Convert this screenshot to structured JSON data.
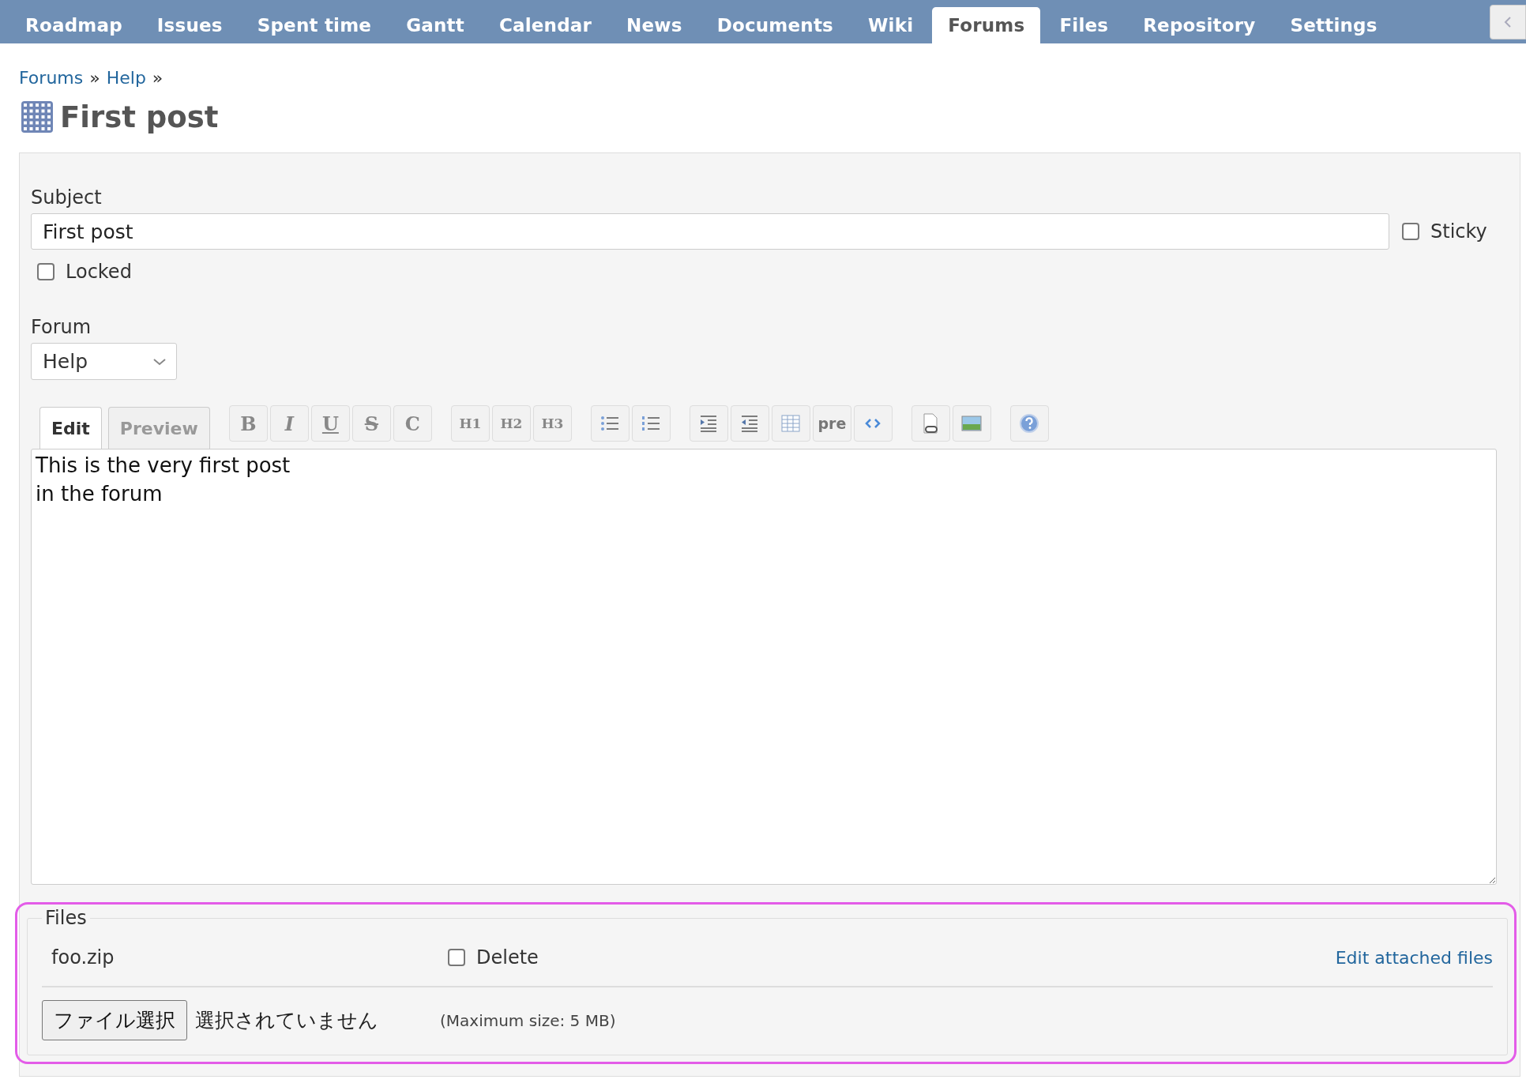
{
  "tabs": [
    {
      "label": "Roadmap",
      "selected": false
    },
    {
      "label": "Issues",
      "selected": false
    },
    {
      "label": "Spent time",
      "selected": false
    },
    {
      "label": "Gantt",
      "selected": false
    },
    {
      "label": "Calendar",
      "selected": false
    },
    {
      "label": "News",
      "selected": false
    },
    {
      "label": "Documents",
      "selected": false
    },
    {
      "label": "Wiki",
      "selected": false
    },
    {
      "label": "Forums",
      "selected": true
    },
    {
      "label": "Files",
      "selected": false
    },
    {
      "label": "Repository",
      "selected": false
    },
    {
      "label": "Settings",
      "selected": false
    }
  ],
  "breadcrumb": [
    {
      "label": "Forums",
      "separator": "»"
    },
    {
      "label": "Help",
      "separator": "»"
    }
  ],
  "title": "First post",
  "form": {
    "subject_label": "Subject",
    "subject_value": "First post",
    "sticky": {
      "label": "Sticky",
      "checked": false
    },
    "locked": {
      "label": "Locked",
      "checked": false
    },
    "forum_label": "Forum",
    "forum_value": "Help",
    "editor_tabs": [
      {
        "label": "Edit",
        "selected": true
      },
      {
        "label": "Preview",
        "selected": false
      }
    ],
    "toolbar": [
      [
        {
          "kind": "bold",
          "label": "B"
        },
        {
          "kind": "italic",
          "label": "I"
        },
        {
          "kind": "underline",
          "label": "U"
        },
        {
          "kind": "strike",
          "label": "S"
        },
        {
          "kind": "code",
          "label": "C"
        }
      ],
      [
        {
          "kind": "heading",
          "label": "H1"
        },
        {
          "kind": "heading",
          "label": "H2"
        },
        {
          "kind": "heading",
          "label": "H3"
        }
      ],
      [
        {
          "kind": "ul"
        },
        {
          "kind": "ol"
        }
      ],
      [
        {
          "kind": "indent"
        },
        {
          "kind": "outdent"
        },
        {
          "kind": "table"
        },
        {
          "kind": "pre",
          "label": "pre"
        },
        {
          "kind": "codeblock"
        }
      ],
      [
        {
          "kind": "link"
        },
        {
          "kind": "image"
        }
      ],
      [
        {
          "kind": "help"
        }
      ]
    ],
    "body": "This is the very first post\nin the forum"
  },
  "files": {
    "legend": "Files",
    "attachments": [
      {
        "name": "foo.zip",
        "delete_label": "Delete",
        "delete_checked": false
      }
    ],
    "edit_link": "Edit attached files",
    "choose_button": "ファイル選択",
    "no_file": "選択されていません",
    "max_size": "(Maximum size: 5 MB)"
  }
}
